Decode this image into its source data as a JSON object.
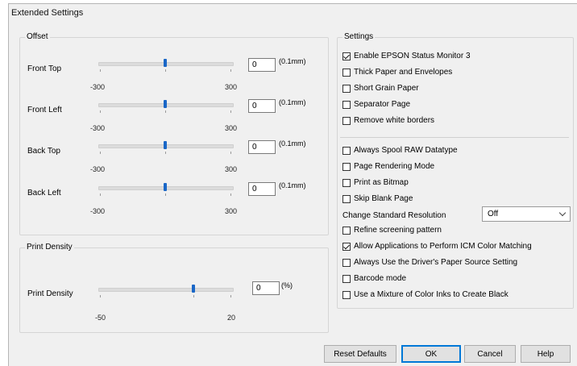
{
  "window": {
    "title": "Extended Settings"
  },
  "offset": {
    "group_label": "Offset",
    "unit": "(0.1mm)",
    "min_label": "-300",
    "max_label": "300",
    "rows": [
      {
        "label": "Front Top",
        "value": "0"
      },
      {
        "label": "Front Left",
        "value": "0"
      },
      {
        "label": "Back Top",
        "value": "0"
      },
      {
        "label": "Back Left",
        "value": "0"
      }
    ]
  },
  "print_density": {
    "group_label": "Print Density",
    "label": "Print Density",
    "value": "0",
    "unit": "(%)",
    "min_label": "-50",
    "max_label": "20"
  },
  "settings": {
    "group_label": "Settings",
    "group1": [
      {
        "label": "Enable EPSON Status Monitor 3",
        "checked": true
      },
      {
        "label": "Thick Paper and Envelopes",
        "checked": false
      },
      {
        "label": "Short Grain Paper",
        "checked": false
      },
      {
        "label": "Separator Page",
        "checked": false
      },
      {
        "label": "Remove white borders",
        "checked": false
      }
    ],
    "group2a": [
      {
        "label": "Always Spool RAW Datatype",
        "checked": false
      },
      {
        "label": "Page Rendering Mode",
        "checked": false
      },
      {
        "label": "Print as Bitmap",
        "checked": false
      },
      {
        "label": "Skip Blank Page",
        "checked": false
      }
    ],
    "resolution_label": "Change Standard Resolution",
    "resolution_value": "Off",
    "group2b": [
      {
        "label": "Refine screening pattern",
        "checked": false
      },
      {
        "label": "Allow Applications to Perform ICM Color Matching",
        "checked": true
      },
      {
        "label": "Always Use the Driver's Paper Source Setting",
        "checked": false
      },
      {
        "label": "Barcode mode",
        "checked": false
      },
      {
        "label": "Use a Mixture of Color Inks to Create Black",
        "checked": false
      }
    ]
  },
  "buttons": {
    "reset": "Reset Defaults",
    "ok": "OK",
    "cancel": "Cancel",
    "help": "Help"
  }
}
